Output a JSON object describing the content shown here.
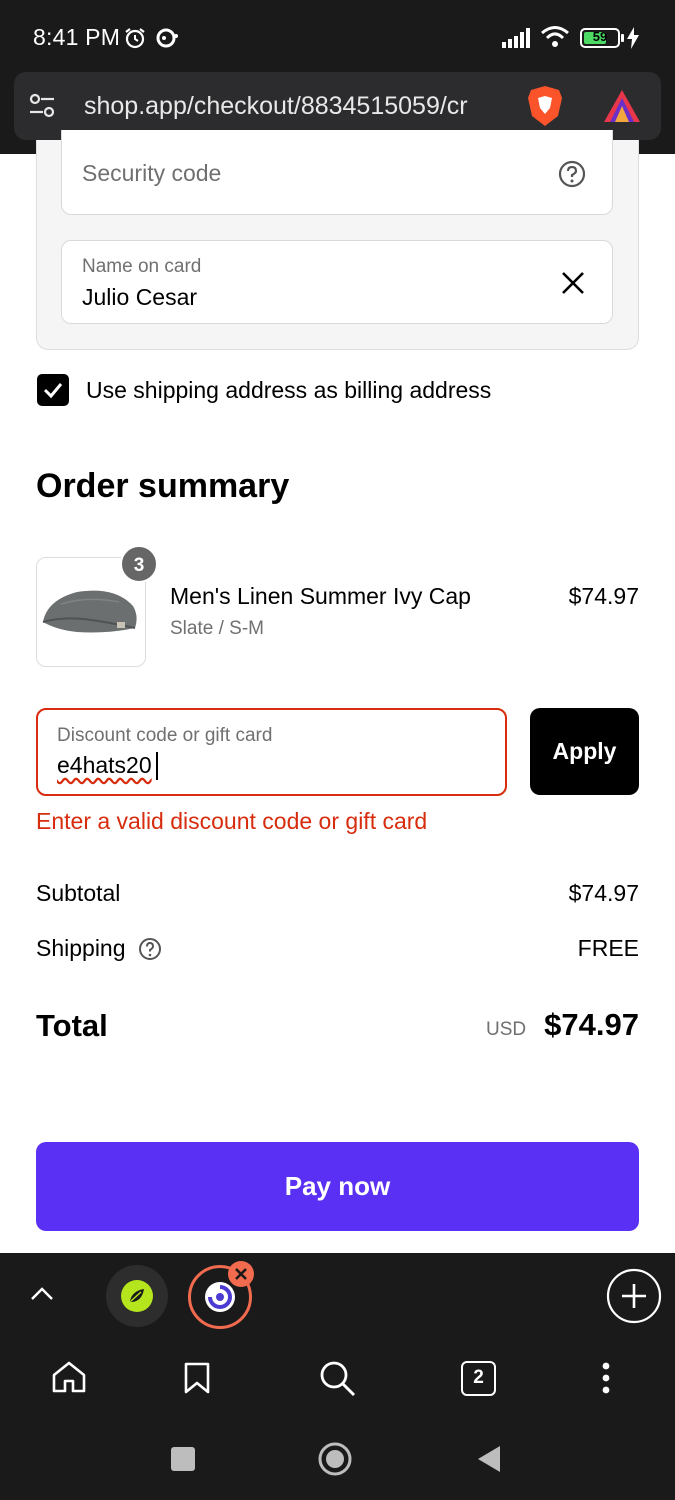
{
  "status": {
    "time": "8:41 PM",
    "battery": "59"
  },
  "browser": {
    "url": "shop.app/checkout/8834515059/cr",
    "tab_count": "2"
  },
  "payment": {
    "security_code_placeholder": "Security code",
    "name_label": "Name on card",
    "name_value": "Julio Cesar",
    "billing_checkbox_label": "Use shipping address as billing address"
  },
  "order": {
    "heading": "Order summary",
    "item": {
      "quantity": "3",
      "name": "Men's Linen Summer Ivy Cap",
      "variant": "Slate / S-M",
      "price": "$74.97"
    },
    "discount": {
      "label": "Discount code or gift card",
      "value": "e4hats20",
      "apply_label": "Apply",
      "error": "Enter a valid discount code or gift card"
    },
    "subtotal_label": "Subtotal",
    "subtotal_value": "$74.97",
    "shipping_label": "Shipping",
    "shipping_value": "FREE",
    "total_label": "Total",
    "total_currency": "USD",
    "total_value": "$74.97",
    "pay_label": "Pay now"
  },
  "colors": {
    "accent": "#5a31f4",
    "error": "#d72c0d"
  }
}
